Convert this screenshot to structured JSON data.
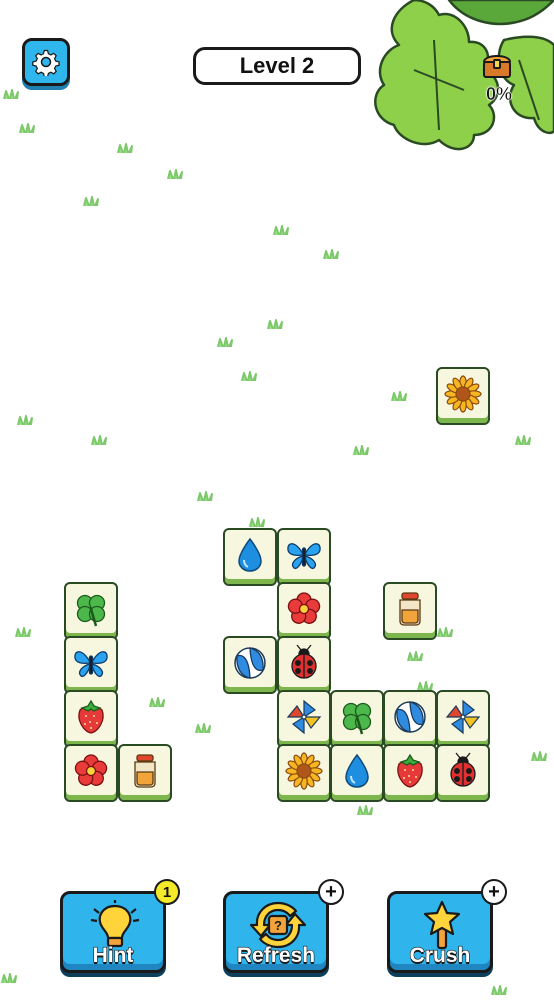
{
  "header": {
    "level_label": "Level 2",
    "collection_progress": "0%",
    "settings_icon": "gear-icon",
    "chest_icon": "treasure-chest-icon"
  },
  "board": {
    "tiles": [
      {
        "item": "sunflower"
      },
      {
        "item": "water-drop"
      },
      {
        "item": "butterfly"
      },
      {
        "item": "red-flower"
      },
      {
        "item": "honey-jar"
      },
      {
        "item": "clover"
      },
      {
        "item": "butterfly"
      },
      {
        "item": "beach-ball"
      },
      {
        "item": "ladybug"
      },
      {
        "item": "strawberry"
      },
      {
        "item": "pinwheel"
      },
      {
        "item": "clover"
      },
      {
        "item": "beach-ball"
      },
      {
        "item": "pinwheel"
      },
      {
        "item": "red-flower"
      },
      {
        "item": "honey-jar"
      },
      {
        "item": "sunflower"
      },
      {
        "item": "water-drop"
      },
      {
        "item": "strawberry"
      },
      {
        "item": "ladybug"
      }
    ]
  },
  "boosters": {
    "hint": {
      "label": "Hint",
      "count": "1",
      "icon": "lightbulb-icon"
    },
    "refresh": {
      "label": "Refresh",
      "badge": "+",
      "icon": "refresh-icon"
    },
    "crush": {
      "label": "Crush",
      "badge": "+",
      "icon": "star-hammer-icon"
    }
  },
  "colors": {
    "button_blue": "#30b4ec",
    "tile_face": "#f7f7df",
    "tile_base": "#7db64c",
    "badge_yellow": "#f5ea2a"
  }
}
